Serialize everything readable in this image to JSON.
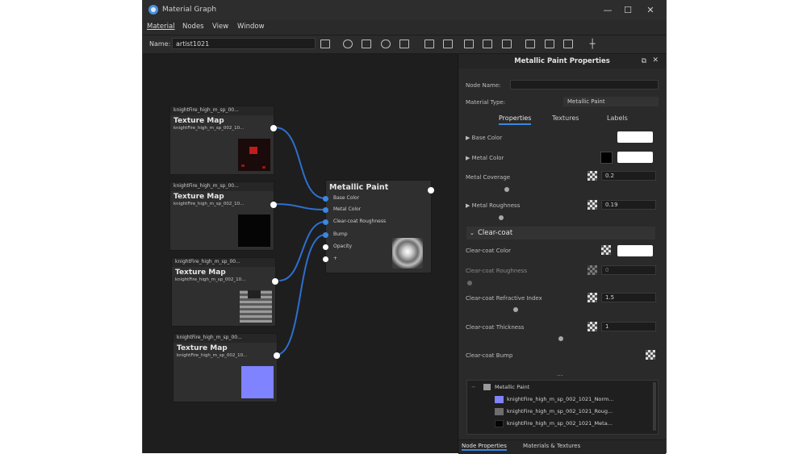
{
  "window": {
    "title": "Material Graph",
    "min": "—",
    "max": "☐",
    "close": "✕"
  },
  "menu": [
    "Material",
    "Nodes",
    "View",
    "Window"
  ],
  "toolbar": {
    "name_label": "Name:",
    "name_value": "artist1021"
  },
  "texture_nodes": [
    {
      "header": "knightFire_high_m_sp_00...",
      "title": "Texture Map",
      "path": "knightFire_high_m_sp_002_10...",
      "thumb_color": "#8a1b1b"
    },
    {
      "header": "knightFire_high_m_sp_00...",
      "title": "Texture Map",
      "path": "knightFire_high_m_sp_002_10...",
      "thumb_color": "#050505"
    },
    {
      "header": "knightFire_high_m_sp_00...",
      "title": "Texture Map",
      "path": "knightFire_high_m_sp_002_10...",
      "thumb_color": "#6e6e6e"
    },
    {
      "header": "knightFire_high_m_sp_00...",
      "title": "Texture Map",
      "path": "knightFire_high_m_sp_002_10...",
      "thumb_color": "#7f83ff"
    }
  ],
  "metallic_node": {
    "title": "Metallic Paint",
    "ports": [
      "Base Color",
      "Metal Color",
      "Clear-coat Roughness",
      "Bump",
      "Opacity",
      "+"
    ]
  },
  "panel": {
    "title": "Metallic Paint Properties",
    "node_name_label": "Node Name:",
    "node_name_value": "",
    "material_type_label": "Material Type:",
    "material_type_value": "Metallic Paint",
    "tabs": [
      "Properties",
      "Textures",
      "Labels"
    ],
    "base_color_label": "Base Color",
    "metal_color_label": "Metal Color",
    "metal_coverage_label": "Metal Coverage",
    "metal_coverage_value": "0.2",
    "metal_roughness_label": "Metal Roughness",
    "metal_roughness_value": "0.19",
    "section_clear_coat": "Clear-coat",
    "cc_color_label": "Clear-coat Color",
    "cc_roughness_label": "Clear-coat Roughness",
    "cc_roughness_value": "0",
    "cc_ior_label": "Clear-coat Refractive Index",
    "cc_ior_value": "1.5",
    "cc_thickness_label": "Clear-coat Thickness",
    "cc_thickness_value": "1",
    "cc_bump_label": "Clear-coat Bump",
    "more": "...",
    "tree": [
      {
        "label": "Metallic Paint",
        "color": "#9a9a9a"
      },
      {
        "label": "knightFire_high_m_sp_002_1021_Norm...",
        "color": "#7f83ff"
      },
      {
        "label": "knightFire_high_m_sp_002_1021_Roug...",
        "color": "#6e6e6e"
      },
      {
        "label": "knightFire_high_m_sp_002_1021_Meta...",
        "color": "#050505"
      }
    ]
  },
  "bottom_tabs": [
    "Node Properties",
    "Materials & Textures"
  ]
}
